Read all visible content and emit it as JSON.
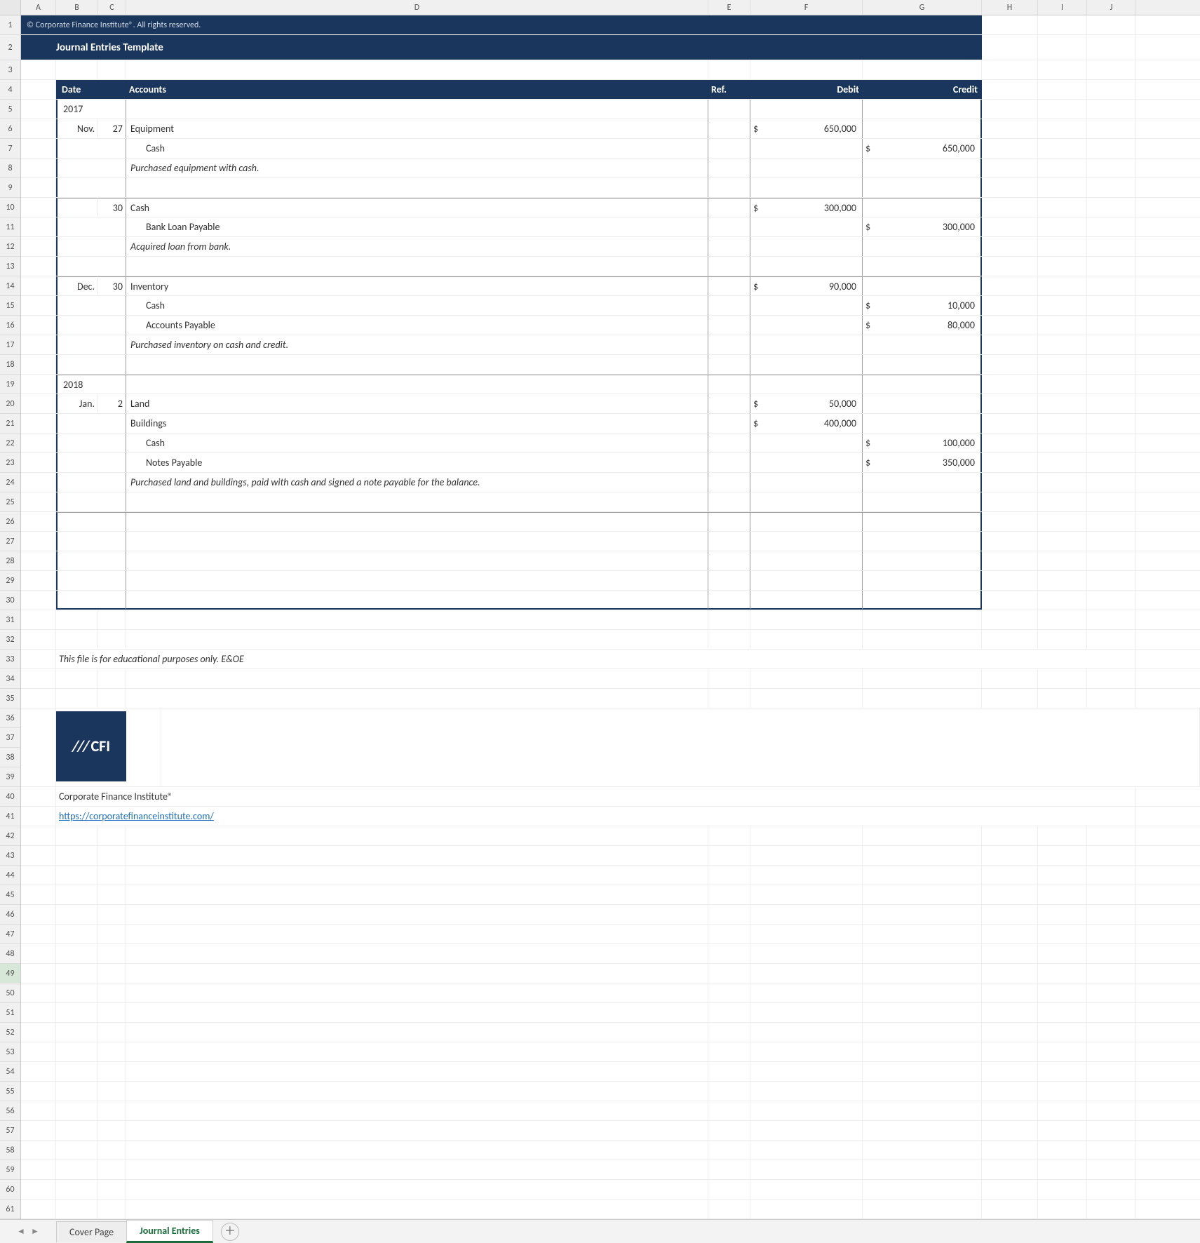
{
  "columns": [
    "A",
    "B",
    "C",
    "D",
    "E",
    "F",
    "G",
    "H",
    "I",
    "J"
  ],
  "rowCount": 61,
  "banner": {
    "copyright": "© Corporate Finance Institute®. All rights reserved.",
    "title": "Journal Entries Template"
  },
  "tableHeaders": {
    "date": "Date",
    "accounts": "Accounts",
    "ref": "Ref.",
    "debit": "Debit",
    "credit": "Credit"
  },
  "entries": {
    "y2017": "2017",
    "e1_date_m": "Nov.",
    "e1_date_d": "27",
    "e1_l1": "Equipment",
    "e1_l2": "Cash",
    "e1_desc": "Purchased equipment with cash.",
    "e1_debit1": "650,000",
    "e1_credit1": "650,000",
    "e2_date_d": "30",
    "e2_l1": "Cash",
    "e2_l2": "Bank Loan Payable",
    "e2_desc": "Acquired loan from bank.",
    "e2_debit1": "300,000",
    "e2_credit1": "300,000",
    "e3_date_m": "Dec.",
    "e3_date_d": "30",
    "e3_l1": "Inventory",
    "e3_l2": "Cash",
    "e3_l3": "Accounts Payable",
    "e3_desc": "Purchased inventory on cash and credit.",
    "e3_debit1": "90,000",
    "e3_credit1": "10,000",
    "e3_credit2": "80,000",
    "y2018": "2018",
    "e4_date_m": "Jan.",
    "e4_date_d": "2",
    "e4_l1": "Land",
    "e4_l2": "Buildings",
    "e4_l3": "Cash",
    "e4_l4": "Notes Payable",
    "e4_desc": "Purchased land and buildings, paid with cash and signed a note payable for the balance.",
    "e4_debit1": "50,000",
    "e4_debit2": "400,000",
    "e4_credit1": "100,000",
    "e4_credit2": "350,000"
  },
  "footer": {
    "disclaimer": "This file is for educational purposes only. E&OE",
    "logoText": "CFI",
    "org": "Corporate Finance Institute®",
    "link": "https://corporatefinanceinstitute.com/"
  },
  "sheetTabs": {
    "tab1": "Cover Page",
    "tab2": "Journal Entries"
  },
  "currencySymbol": "$"
}
